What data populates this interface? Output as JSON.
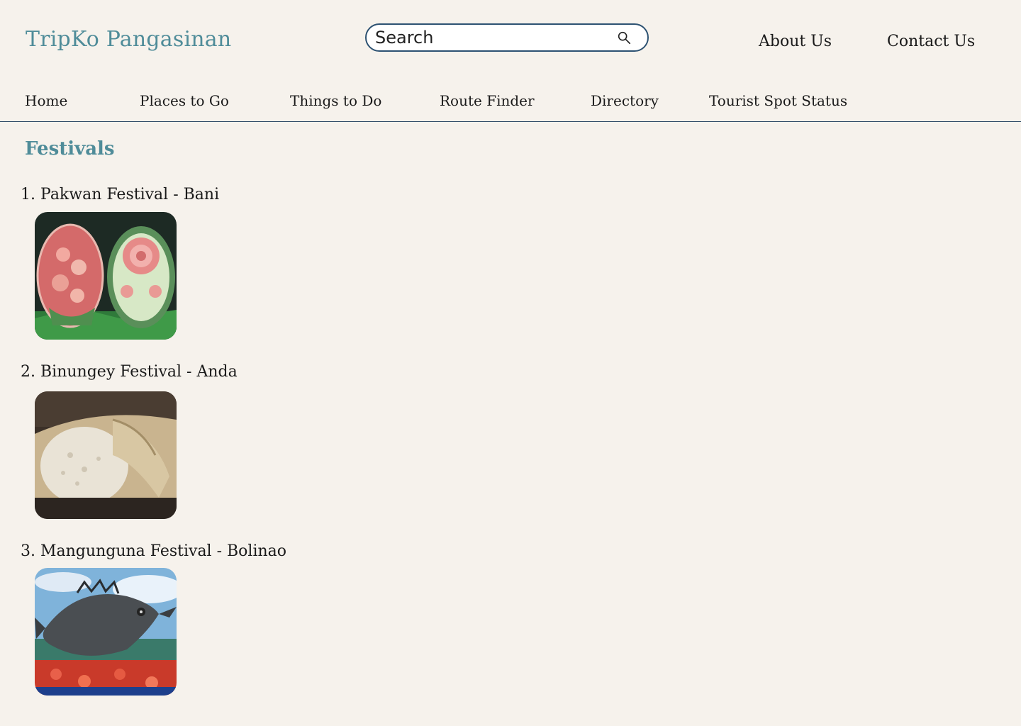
{
  "header": {
    "brand": "TripKo Pangasinan",
    "search_placeholder": "Search",
    "about_label": "About Us",
    "contact_label": "Contact Us"
  },
  "nav": {
    "items": [
      {
        "label": "Home"
      },
      {
        "label": "Places to Go"
      },
      {
        "label": "Things to Do"
      },
      {
        "label": "Route Finder"
      },
      {
        "label": "Directory"
      },
      {
        "label": "Tourist Spot Status"
      }
    ]
  },
  "main": {
    "section_title": "Festivals",
    "festivals": [
      {
        "number": "1.",
        "name": "Pakwan Festival - Bani",
        "image": "carved-watermelon-image"
      },
      {
        "number": "2.",
        "name": "Binungey Festival - Anda",
        "image": "bamboo-rice-image"
      },
      {
        "number": "3.",
        "name": "Mangunguna Festival - Bolinao",
        "image": "fish-sculpture-image"
      }
    ]
  },
  "colors": {
    "background": "#f6f2ec",
    "brand": "#4f8c99",
    "search_border": "#2d5272",
    "nav_divider": "#2d4a66"
  }
}
